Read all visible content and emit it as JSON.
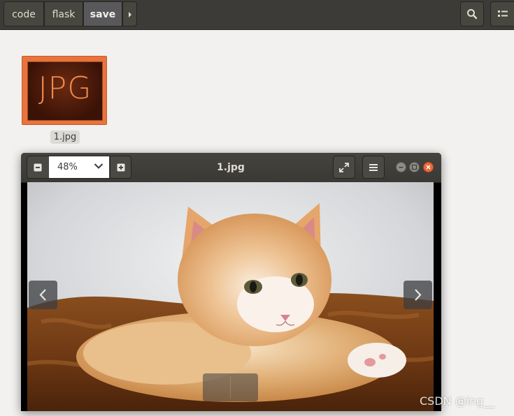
{
  "pathbar": {
    "crumbs": [
      "code",
      "flask",
      "save"
    ],
    "active": "save",
    "search_icon": "search-icon",
    "view_icon": "list-view-icon"
  },
  "desktop": {
    "file_icon_text": "JPG",
    "file_name": "1.jpg"
  },
  "viewer": {
    "title": "1.jpg",
    "zoom_value": "48%",
    "zoom_minus_icon": "minus-icon",
    "zoom_plus_icon": "plus-icon",
    "fullscreen_icon": "fullscreen-icon",
    "menu_icon": "hamburger-menu-icon",
    "window_buttons": [
      "minimize",
      "maximize",
      "close"
    ],
    "accent_close": "#e9693b"
  },
  "watermark": "CSDN @ing__"
}
